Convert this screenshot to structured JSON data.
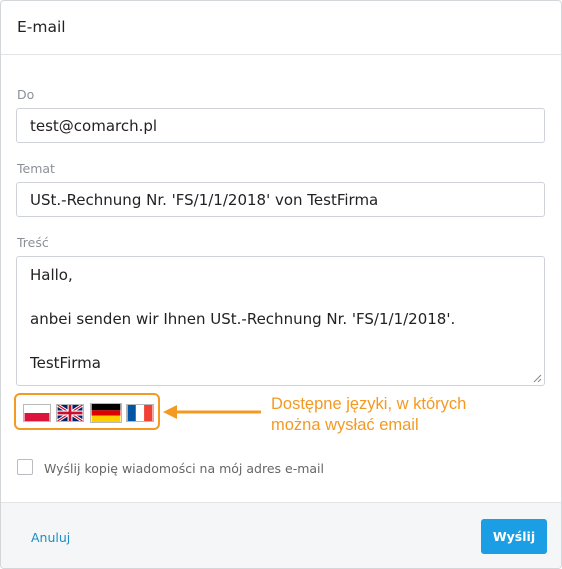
{
  "dialog": {
    "title": "E-mail"
  },
  "to": {
    "label": "Do",
    "value": "test@comarch.pl"
  },
  "subject": {
    "label": "Temat",
    "value": "USt.-Rechnung Nr. 'FS/1/1/2018' von TestFirma"
  },
  "body": {
    "label": "Treść",
    "lines": [
      "Hallo,",
      "anbei senden wir Ihnen USt.-Rechnung Nr. 'FS/1/1/2018'.",
      "TestFirma"
    ]
  },
  "languages": {
    "flags": [
      {
        "icon": "poland-flag-icon"
      },
      {
        "icon": "uk-flag-icon"
      },
      {
        "icon": "germany-flag-icon"
      },
      {
        "icon": "france-flag-icon"
      }
    ],
    "annotation_lines": [
      "Dostępne języki, w których",
      "można wysłać email"
    ],
    "annotation_color": "#f39a23"
  },
  "copy_option": {
    "label": "Wyślij kopię wiadomości na mój adres e-mail",
    "checked": false
  },
  "footer": {
    "cancel_label": "Anuluj",
    "send_label": "Wyślij",
    "send_color": "#1b9ee3"
  }
}
